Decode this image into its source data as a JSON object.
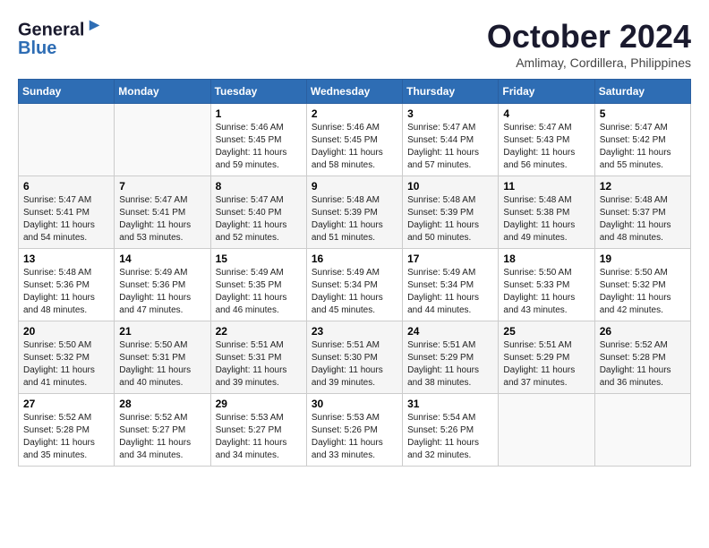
{
  "logo": {
    "line1": "General",
    "line2": "Blue"
  },
  "title": "October 2024",
  "location": "Amlimay, Cordillera, Philippines",
  "days_header": [
    "Sunday",
    "Monday",
    "Tuesday",
    "Wednesday",
    "Thursday",
    "Friday",
    "Saturday"
  ],
  "weeks": [
    [
      {
        "day": "",
        "sunrise": "",
        "sunset": "",
        "daylight": ""
      },
      {
        "day": "",
        "sunrise": "",
        "sunset": "",
        "daylight": ""
      },
      {
        "day": "1",
        "sunrise": "Sunrise: 5:46 AM",
        "sunset": "Sunset: 5:45 PM",
        "daylight": "Daylight: 11 hours and 59 minutes."
      },
      {
        "day": "2",
        "sunrise": "Sunrise: 5:46 AM",
        "sunset": "Sunset: 5:45 PM",
        "daylight": "Daylight: 11 hours and 58 minutes."
      },
      {
        "day": "3",
        "sunrise": "Sunrise: 5:47 AM",
        "sunset": "Sunset: 5:44 PM",
        "daylight": "Daylight: 11 hours and 57 minutes."
      },
      {
        "day": "4",
        "sunrise": "Sunrise: 5:47 AM",
        "sunset": "Sunset: 5:43 PM",
        "daylight": "Daylight: 11 hours and 56 minutes."
      },
      {
        "day": "5",
        "sunrise": "Sunrise: 5:47 AM",
        "sunset": "Sunset: 5:42 PM",
        "daylight": "Daylight: 11 hours and 55 minutes."
      }
    ],
    [
      {
        "day": "6",
        "sunrise": "Sunrise: 5:47 AM",
        "sunset": "Sunset: 5:41 PM",
        "daylight": "Daylight: 11 hours and 54 minutes."
      },
      {
        "day": "7",
        "sunrise": "Sunrise: 5:47 AM",
        "sunset": "Sunset: 5:41 PM",
        "daylight": "Daylight: 11 hours and 53 minutes."
      },
      {
        "day": "8",
        "sunrise": "Sunrise: 5:47 AM",
        "sunset": "Sunset: 5:40 PM",
        "daylight": "Daylight: 11 hours and 52 minutes."
      },
      {
        "day": "9",
        "sunrise": "Sunrise: 5:48 AM",
        "sunset": "Sunset: 5:39 PM",
        "daylight": "Daylight: 11 hours and 51 minutes."
      },
      {
        "day": "10",
        "sunrise": "Sunrise: 5:48 AM",
        "sunset": "Sunset: 5:39 PM",
        "daylight": "Daylight: 11 hours and 50 minutes."
      },
      {
        "day": "11",
        "sunrise": "Sunrise: 5:48 AM",
        "sunset": "Sunset: 5:38 PM",
        "daylight": "Daylight: 11 hours and 49 minutes."
      },
      {
        "day": "12",
        "sunrise": "Sunrise: 5:48 AM",
        "sunset": "Sunset: 5:37 PM",
        "daylight": "Daylight: 11 hours and 48 minutes."
      }
    ],
    [
      {
        "day": "13",
        "sunrise": "Sunrise: 5:48 AM",
        "sunset": "Sunset: 5:36 PM",
        "daylight": "Daylight: 11 hours and 48 minutes."
      },
      {
        "day": "14",
        "sunrise": "Sunrise: 5:49 AM",
        "sunset": "Sunset: 5:36 PM",
        "daylight": "Daylight: 11 hours and 47 minutes."
      },
      {
        "day": "15",
        "sunrise": "Sunrise: 5:49 AM",
        "sunset": "Sunset: 5:35 PM",
        "daylight": "Daylight: 11 hours and 46 minutes."
      },
      {
        "day": "16",
        "sunrise": "Sunrise: 5:49 AM",
        "sunset": "Sunset: 5:34 PM",
        "daylight": "Daylight: 11 hours and 45 minutes."
      },
      {
        "day": "17",
        "sunrise": "Sunrise: 5:49 AM",
        "sunset": "Sunset: 5:34 PM",
        "daylight": "Daylight: 11 hours and 44 minutes."
      },
      {
        "day": "18",
        "sunrise": "Sunrise: 5:50 AM",
        "sunset": "Sunset: 5:33 PM",
        "daylight": "Daylight: 11 hours and 43 minutes."
      },
      {
        "day": "19",
        "sunrise": "Sunrise: 5:50 AM",
        "sunset": "Sunset: 5:32 PM",
        "daylight": "Daylight: 11 hours and 42 minutes."
      }
    ],
    [
      {
        "day": "20",
        "sunrise": "Sunrise: 5:50 AM",
        "sunset": "Sunset: 5:32 PM",
        "daylight": "Daylight: 11 hours and 41 minutes."
      },
      {
        "day": "21",
        "sunrise": "Sunrise: 5:50 AM",
        "sunset": "Sunset: 5:31 PM",
        "daylight": "Daylight: 11 hours and 40 minutes."
      },
      {
        "day": "22",
        "sunrise": "Sunrise: 5:51 AM",
        "sunset": "Sunset: 5:31 PM",
        "daylight": "Daylight: 11 hours and 39 minutes."
      },
      {
        "day": "23",
        "sunrise": "Sunrise: 5:51 AM",
        "sunset": "Sunset: 5:30 PM",
        "daylight": "Daylight: 11 hours and 39 minutes."
      },
      {
        "day": "24",
        "sunrise": "Sunrise: 5:51 AM",
        "sunset": "Sunset: 5:29 PM",
        "daylight": "Daylight: 11 hours and 38 minutes."
      },
      {
        "day": "25",
        "sunrise": "Sunrise: 5:51 AM",
        "sunset": "Sunset: 5:29 PM",
        "daylight": "Daylight: 11 hours and 37 minutes."
      },
      {
        "day": "26",
        "sunrise": "Sunrise: 5:52 AM",
        "sunset": "Sunset: 5:28 PM",
        "daylight": "Daylight: 11 hours and 36 minutes."
      }
    ],
    [
      {
        "day": "27",
        "sunrise": "Sunrise: 5:52 AM",
        "sunset": "Sunset: 5:28 PM",
        "daylight": "Daylight: 11 hours and 35 minutes."
      },
      {
        "day": "28",
        "sunrise": "Sunrise: 5:52 AM",
        "sunset": "Sunset: 5:27 PM",
        "daylight": "Daylight: 11 hours and 34 minutes."
      },
      {
        "day": "29",
        "sunrise": "Sunrise: 5:53 AM",
        "sunset": "Sunset: 5:27 PM",
        "daylight": "Daylight: 11 hours and 34 minutes."
      },
      {
        "day": "30",
        "sunrise": "Sunrise: 5:53 AM",
        "sunset": "Sunset: 5:26 PM",
        "daylight": "Daylight: 11 hours and 33 minutes."
      },
      {
        "day": "31",
        "sunrise": "Sunrise: 5:54 AM",
        "sunset": "Sunset: 5:26 PM",
        "daylight": "Daylight: 11 hours and 32 minutes."
      },
      {
        "day": "",
        "sunrise": "",
        "sunset": "",
        "daylight": ""
      },
      {
        "day": "",
        "sunrise": "",
        "sunset": "",
        "daylight": ""
      }
    ]
  ]
}
